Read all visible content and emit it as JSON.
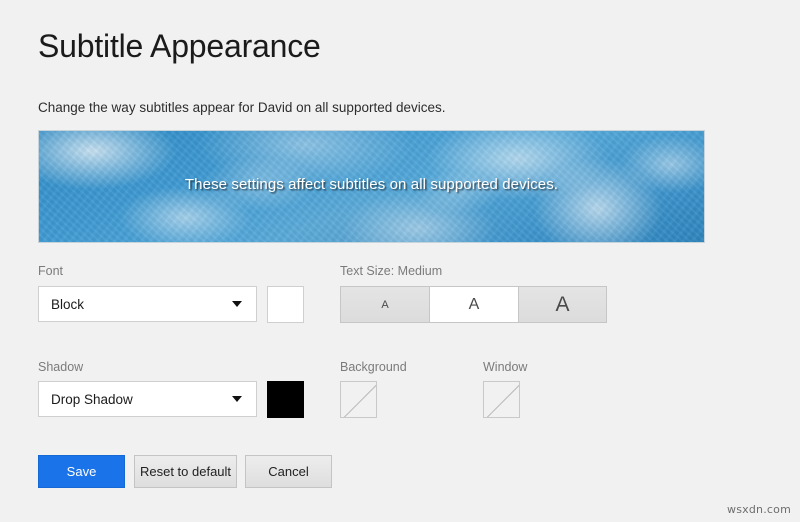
{
  "header": {
    "title": "Subtitle Appearance",
    "description": "Change the way subtitles appear for David on all supported devices."
  },
  "preview": {
    "caption": "These settings affect subtitles on all supported devices.",
    "background_image": "sky-clouds-image",
    "caption_color": "#ffffff",
    "shadow_color": "#000000"
  },
  "controls": {
    "font": {
      "label": "Font",
      "value": "Block",
      "color_swatch": "#ffffff",
      "arrow_icon": "chevron-down-icon"
    },
    "text_size": {
      "label": "Text Size: Medium",
      "value": "Medium",
      "options": [
        {
          "label": "A",
          "size": "Small",
          "selected": false
        },
        {
          "label": "A",
          "size": "Medium",
          "selected": true
        },
        {
          "label": "A",
          "size": "Large",
          "selected": false
        }
      ]
    },
    "shadow": {
      "label": "Shadow",
      "value": "Drop Shadow",
      "color_swatch": "#000000",
      "arrow_icon": "chevron-down-icon"
    },
    "background": {
      "label": "Background",
      "color_swatch": "none"
    },
    "window": {
      "label": "Window",
      "color_swatch": "none"
    }
  },
  "footer": {
    "save_label": "Save",
    "reset_label": "Reset to default",
    "cancel_label": "Cancel",
    "primary_color": "#1a73e8"
  },
  "watermark": {
    "text": "wsxdn.com"
  }
}
